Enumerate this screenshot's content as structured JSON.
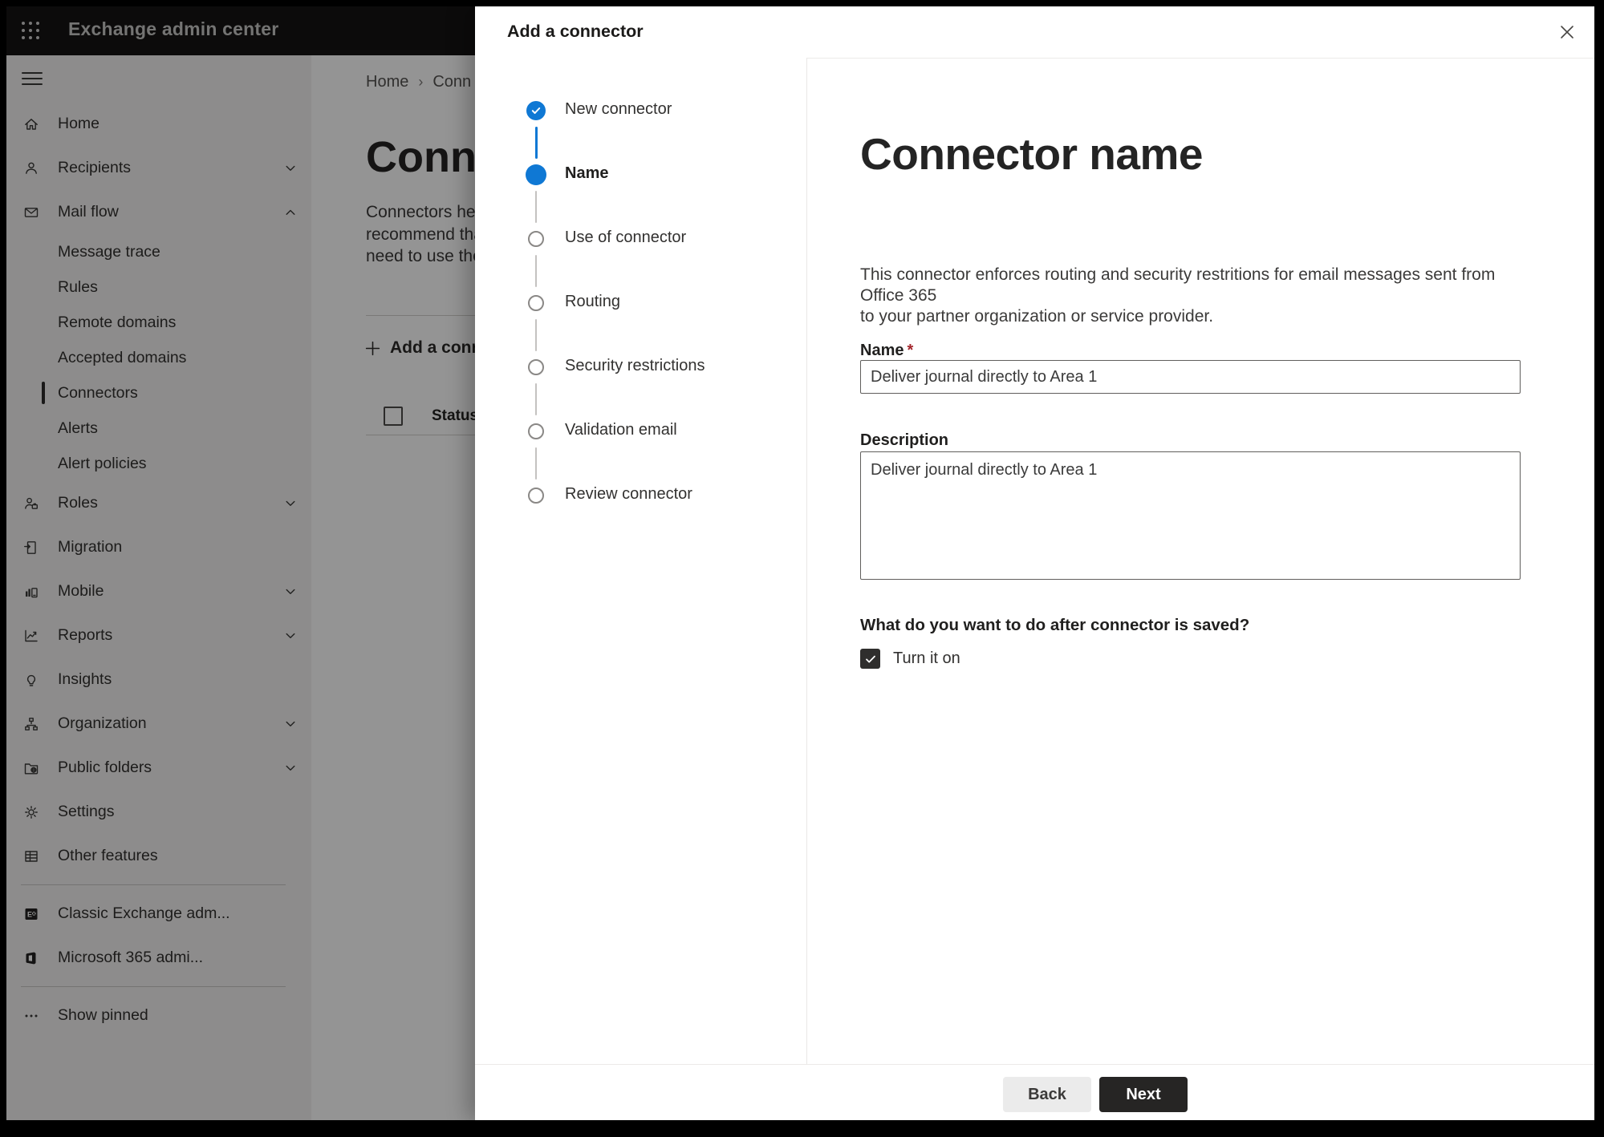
{
  "topbar": {
    "title": "Exchange admin center"
  },
  "sidebar": {
    "items": [
      {
        "label": "Home",
        "icon": "home-icon"
      },
      {
        "label": "Recipients",
        "icon": "person-icon",
        "chevron": "down"
      },
      {
        "label": "Mail flow",
        "icon": "mail-icon",
        "chevron": "up"
      },
      {
        "label": "Message trace",
        "sub": true
      },
      {
        "label": "Rules",
        "sub": true
      },
      {
        "label": "Remote domains",
        "sub": true
      },
      {
        "label": "Accepted domains",
        "sub": true
      },
      {
        "label": "Connectors",
        "sub": true,
        "selected": true
      },
      {
        "label": "Alerts",
        "sub": true
      },
      {
        "label": "Alert policies",
        "sub": true
      },
      {
        "label": "Roles",
        "icon": "roles-icon",
        "chevron": "down"
      },
      {
        "label": "Migration",
        "icon": "migration-icon"
      },
      {
        "label": "Mobile",
        "icon": "mobile-icon",
        "chevron": "down"
      },
      {
        "label": "Reports",
        "icon": "reports-icon",
        "chevron": "down"
      },
      {
        "label": "Insights",
        "icon": "lightbulb-icon"
      },
      {
        "label": "Organization",
        "icon": "org-tree-icon",
        "chevron": "down"
      },
      {
        "label": "Public folders",
        "icon": "folder-globe-icon",
        "chevron": "down"
      },
      {
        "label": "Settings",
        "icon": "gear-icon"
      },
      {
        "label": "Other features",
        "icon": "grid-table-icon"
      },
      {
        "divider": true
      },
      {
        "label": "Classic Exchange adm...",
        "icon": "exchange-logo-icon"
      },
      {
        "label": "Microsoft 365 admi...",
        "icon": "office-logo-icon"
      },
      {
        "divider": true
      },
      {
        "label": "Show pinned",
        "icon": "ellipsis-icon"
      }
    ]
  },
  "page": {
    "breadcrumb": {
      "home": "Home",
      "current": "Conn"
    },
    "title": "Connec",
    "description_lines": [
      "Connectors help",
      "recommend tha",
      "need to use ther"
    ],
    "add_button_label": "Add a conn",
    "status_header": "Status"
  },
  "dialog": {
    "title": "Add a connector",
    "steps": [
      {
        "label": "New connector",
        "state": "completed"
      },
      {
        "label": "Name",
        "state": "current"
      },
      {
        "label": "Use of connector",
        "state": "pending"
      },
      {
        "label": "Routing",
        "state": "pending"
      },
      {
        "label": "Security restrictions",
        "state": "pending"
      },
      {
        "label": "Validation email",
        "state": "pending"
      },
      {
        "label": "Review connector",
        "state": "pending"
      }
    ],
    "content": {
      "heading": "Connector name",
      "intro_line1": "This connector enforces routing and security restritions for email messages sent from Office 365",
      "intro_line2": "to your partner organization or service provider.",
      "name_label": "Name",
      "required_mark": "*",
      "name_value": "Deliver journal directly to Area 1",
      "description_label": "Description",
      "description_value": "Deliver journal directly to Area 1",
      "after_save_question": "What do you want to do after connector is saved?",
      "turn_on_label": "Turn it on",
      "turn_on_checked": true
    },
    "footer": {
      "back_label": "Back",
      "next_label": "Next"
    }
  },
  "colors": {
    "accent_blue": "#0f78d4",
    "required_red": "#a4262c",
    "topbar_bg": "#151413",
    "sidebar_bg": "#f3f2f1",
    "overlay": "rgba(0,0,0,0.42)"
  }
}
